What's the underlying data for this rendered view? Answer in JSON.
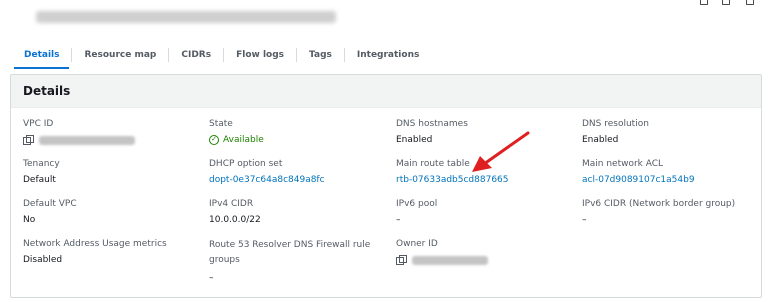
{
  "tabs": [
    {
      "label": "Details",
      "active": true
    },
    {
      "label": "Resource map"
    },
    {
      "label": "CIDRs"
    },
    {
      "label": "Flow logs"
    },
    {
      "label": "Tags"
    },
    {
      "label": "Integrations"
    }
  ],
  "details": {
    "title": "Details",
    "vpc_id": {
      "label": "VPC ID"
    },
    "state": {
      "label": "State",
      "value": "Available"
    },
    "dns_hostnames": {
      "label": "DNS hostnames",
      "value": "Enabled"
    },
    "dns_resolution": {
      "label": "DNS resolution",
      "value": "Enabled"
    },
    "tenancy": {
      "label": "Tenancy",
      "value": "Default"
    },
    "dhcp_option_set": {
      "label": "DHCP option set",
      "value": "dopt-0e37c64a8c849a8fc"
    },
    "main_route_table": {
      "label": "Main route table",
      "value": "rtb-07633adb5cd887665"
    },
    "main_network_acl": {
      "label": "Main network ACL",
      "value": "acl-07d9089107c1a54b9"
    },
    "default_vpc": {
      "label": "Default VPC",
      "value": "No"
    },
    "ipv4_cidr": {
      "label": "IPv4 CIDR",
      "value": "10.0.0.0/22"
    },
    "ipv6_pool": {
      "label": "IPv6 pool",
      "value": "–"
    },
    "ipv6_cidr": {
      "label": "IPv6 CIDR (Network border group)",
      "value": "–"
    },
    "network_address_usage": {
      "label": "Network Address Usage metrics",
      "value": "Disabled"
    },
    "route53_firewall": {
      "label": "Route 53 Resolver DNS Firewall rule groups",
      "value": "–"
    },
    "owner_id": {
      "label": "Owner ID"
    }
  },
  "colors": {
    "link": "#0073bb",
    "accent": "#0972d3",
    "success": "#1d8102",
    "annotation": "#e02020"
  },
  "icons": [
    "copy-icon",
    "status-success-icon",
    "annotation-arrow"
  ]
}
